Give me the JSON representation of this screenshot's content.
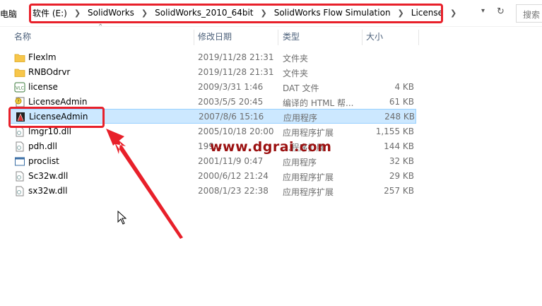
{
  "address": {
    "left_text": "电脑",
    "crumbs": [
      "软件 (E:)",
      "SolidWorks",
      "SolidWorks_2010_64bit",
      "SolidWorks Flow Simulation",
      "License"
    ],
    "search_placeholder": "搜索"
  },
  "columns": {
    "name": "名称",
    "date": "修改日期",
    "type": "类型",
    "size": "大小"
  },
  "files": [
    {
      "name": "Flexlm",
      "date": "2019/11/28 21:31",
      "type": "文件夹",
      "size": "",
      "icon": "folder-icon"
    },
    {
      "name": "RNBOdrvr",
      "date": "2019/11/28 21:31",
      "type": "文件夹",
      "size": "",
      "icon": "folder-icon"
    },
    {
      "name": "license",
      "date": "2009/3/31 1:46",
      "type": "DAT 文件",
      "size": "4 KB",
      "icon": "dat-file-icon"
    },
    {
      "name": "LicenseAdmin",
      "date": "2003/5/5 20:45",
      "type": "编译的 HTML 帮...",
      "size": "61 KB",
      "icon": "help-file-icon"
    },
    {
      "name": "LicenseAdmin",
      "date": "2007/8/6 15:16",
      "type": "应用程序",
      "size": "248 KB",
      "icon": "app-icon",
      "selected": true
    },
    {
      "name": "lmgr10.dll",
      "date": "2005/10/18 20:00",
      "type": "应用程序扩展",
      "size": "1,155 KB",
      "icon": "dll-icon"
    },
    {
      "name": "pdh.dll",
      "date": "199...",
      "type": "...程序扩展",
      "size": "144 KB",
      "icon": "dll-icon"
    },
    {
      "name": "proclist",
      "date": "2001/11/9 0:47",
      "type": "应用程序",
      "size": "32 KB",
      "icon": "app-window-icon"
    },
    {
      "name": "Sc32w.dll",
      "date": "2000/6/12 21:24",
      "type": "应用程序扩展",
      "size": "29 KB",
      "icon": "dll-icon"
    },
    {
      "name": "sx32w.dll",
      "date": "2008/1/23 22:38",
      "type": "应用程序扩展",
      "size": "257 KB",
      "icon": "dll-icon"
    }
  ],
  "watermark": "www.dgrai.com",
  "accent_red": "#e8202a"
}
